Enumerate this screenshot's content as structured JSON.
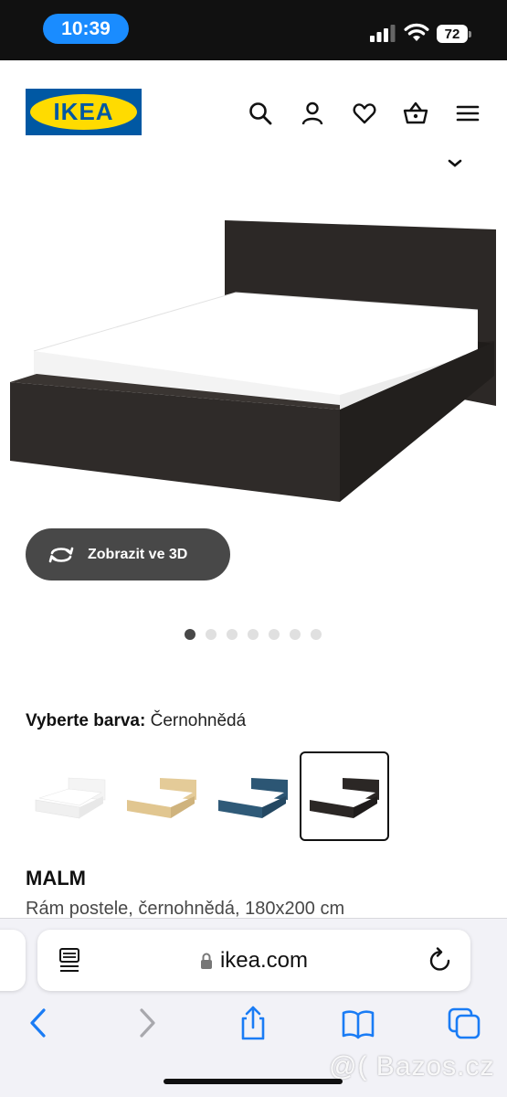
{
  "status_bar": {
    "time": "10:39",
    "battery": "72",
    "signal_icon": "cellular-signal-icon",
    "wifi_icon": "wifi-icon"
  },
  "header": {
    "logo_text": "IKEA",
    "brand_colors": {
      "blue": "#0058a3",
      "yellow": "#ffdb00"
    },
    "icons": [
      "search-icon",
      "account-icon",
      "favorites-heart-icon",
      "shopping-basket-icon",
      "menu-icon"
    ]
  },
  "product": {
    "view_3d_label": "Zobrazit ve 3D",
    "image_count": 7,
    "active_image": 1,
    "color_label": "Vyberte barva:",
    "color_value": "Černohnědá",
    "swatches": [
      {
        "color": "#ffffff",
        "frame": "#f2f2f2"
      },
      {
        "color": "#e6cf9e",
        "frame": "#d9bd85"
      },
      {
        "color": "#2f5a78",
        "frame": "#274c66"
      },
      {
        "color": "#2b2725",
        "frame": "#1f1c1b"
      }
    ],
    "selected_swatch": 4,
    "name": "MALM",
    "description": "Rám postele, černohnědá, 180x200 cm"
  },
  "browser": {
    "url": "ikea.com",
    "icons": [
      "page-menu-icon",
      "lock-icon",
      "reload-icon",
      "back-icon",
      "forward-icon",
      "share-icon",
      "bookmarks-icon",
      "tabs-icon"
    ]
  },
  "watermark": "@( Bazos.cz"
}
